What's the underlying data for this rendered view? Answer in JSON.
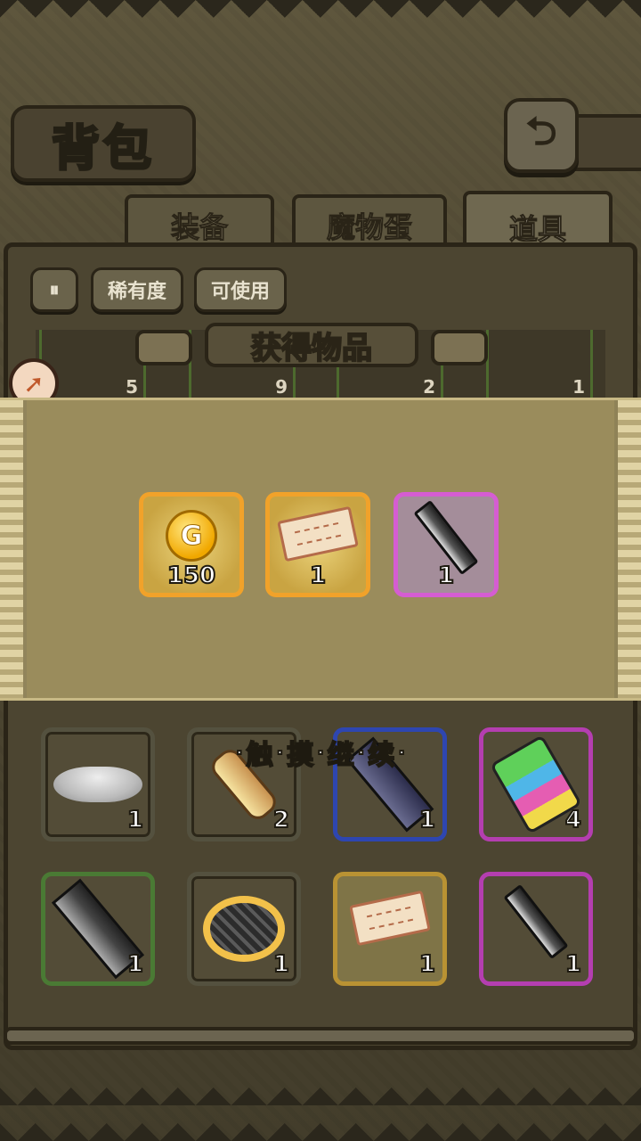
{
  "header": {
    "title": "背包"
  },
  "tabs": [
    {
      "label": "装备",
      "active": false
    },
    {
      "label": "魔物蛋",
      "active": false
    },
    {
      "label": "道具",
      "active": true
    }
  ],
  "filters": {
    "sort_icon": "sort-icon",
    "rarity_label": "稀有度",
    "usable_label": "可使用"
  },
  "partial_row_counts": [
    "5",
    "9",
    "2",
    "1"
  ],
  "popup": {
    "title": "获得物品",
    "rewards": [
      {
        "icon": "gold-coin-icon",
        "coin_letter": "G",
        "count": "150",
        "rarity_color": "#f1a22a"
      },
      {
        "icon": "ticket-icon",
        "count": "1",
        "rarity_color": "#f1a22a"
      },
      {
        "icon": "sword-icon",
        "count": "1",
        "rarity_color": "#d55dd2"
      }
    ]
  },
  "hint": {
    "chars": [
      "触",
      "摸",
      "继",
      "续"
    ]
  },
  "inventory": [
    {
      "icon": "powder-icon",
      "count": "1",
      "rarity_color": "#54513f"
    },
    {
      "icon": "drumstick-icon",
      "count": "2",
      "rarity_color": "#54513f"
    },
    {
      "icon": "dark-crystal-icon",
      "count": "1",
      "rarity_color": "#2e46b0"
    },
    {
      "icon": "popsicle-icon",
      "count": "4",
      "rarity_color": "#b43eb0"
    },
    {
      "icon": "iron-ingot-icon",
      "count": "1",
      "rarity_color": "#4a7a34"
    },
    {
      "icon": "pie-icon",
      "count": "1",
      "rarity_color": "#54513f"
    },
    {
      "icon": "ticket-icon",
      "count": "1",
      "rarity_color": "#b99233"
    },
    {
      "icon": "sword-icon",
      "count": "1",
      "rarity_color": "#b43eb0"
    }
  ]
}
